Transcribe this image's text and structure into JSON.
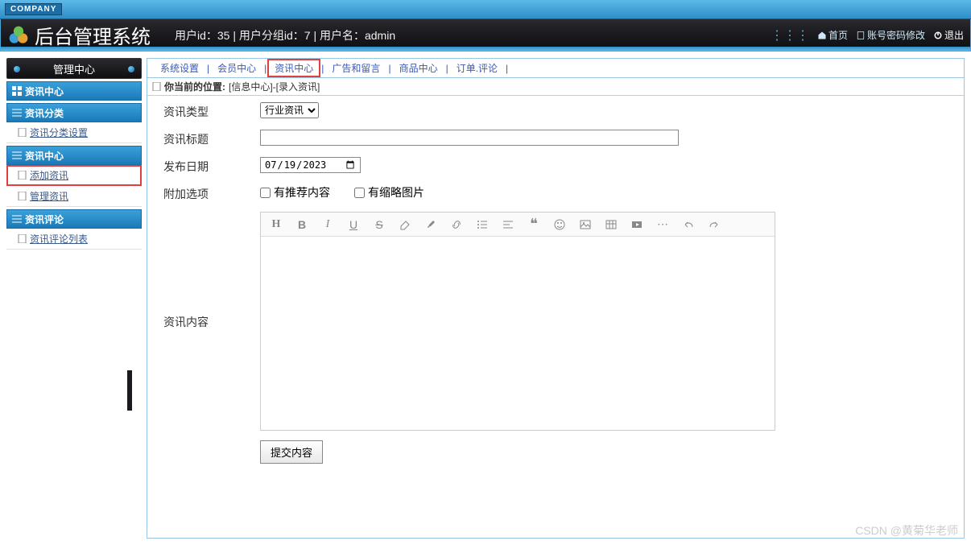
{
  "company_badge": "COMPANY",
  "header": {
    "title": "后台管理系统",
    "user_info": "用户id：35 | 用户分组id：7 | 用户名：admin",
    "links": {
      "home": "首页",
      "account": "账号密码修改",
      "logout": "退出"
    }
  },
  "sidebar": {
    "header": "管理中心",
    "sections": [
      {
        "title": "资讯中心",
        "items": []
      },
      {
        "title": "资讯分类",
        "items": [
          {
            "label": "资讯分类设置"
          }
        ]
      },
      {
        "title": "资讯中心",
        "items": [
          {
            "label": "添加资讯",
            "highlighted": true
          },
          {
            "label": "管理资讯"
          }
        ]
      },
      {
        "title": "资讯评论",
        "items": [
          {
            "label": "资讯评论列表"
          }
        ]
      }
    ]
  },
  "top_nav": {
    "items": [
      {
        "label": "系统设置"
      },
      {
        "label": "会员中心"
      },
      {
        "label": "资讯中心",
        "highlighted": true
      },
      {
        "label": "广告和留言"
      },
      {
        "label": "商品中心"
      },
      {
        "label": "订单.评论"
      }
    ]
  },
  "breadcrumb": {
    "prefix": "你当前的位置:",
    "path": "[信息中心]-[录入资讯]"
  },
  "form": {
    "type_label": "资讯类型",
    "type_value": "行业资讯",
    "title_label": "资讯标题",
    "title_value": "",
    "date_label": "发布日期",
    "date_value": "2023/07/19",
    "options_label": "附加选项",
    "opt_recommend": "有推荐内容",
    "opt_thumbnail": "有缩略图片",
    "content_label": "资讯内容",
    "submit_label": "提交内容"
  },
  "toolbar_icons": [
    "heading",
    "bold",
    "italic",
    "underline",
    "strikethrough",
    "eraser",
    "brush",
    "link",
    "list-ul",
    "align",
    "quote",
    "emoji",
    "image",
    "table",
    "video",
    "ellipsis",
    "undo",
    "redo"
  ],
  "watermark": "CSDN @黄菊华老师"
}
